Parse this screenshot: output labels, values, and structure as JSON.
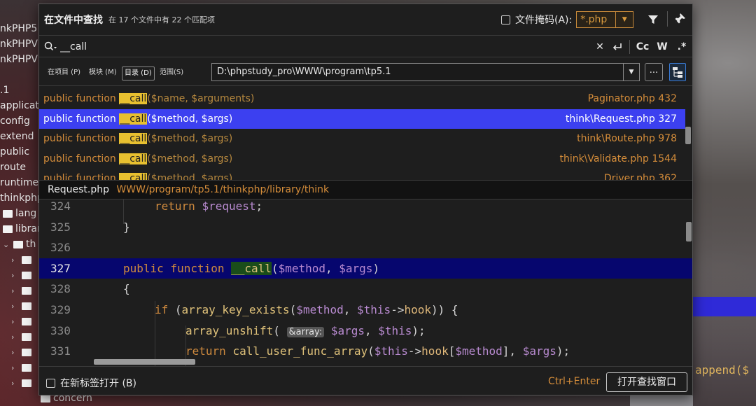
{
  "background": {
    "tree_items": [
      "nkPHP5",
      "nkPHPV",
      "nkPHPV",
      ".1",
      "applicati",
      "config",
      "extend",
      "public",
      "route",
      "runtime",
      "thinkphp",
      "lang",
      "librar",
      "th",
      "concern"
    ],
    "append_text": "append($"
  },
  "dialog": {
    "title": "在文件中查找",
    "match_summary": "在 17 个文件中有 22 个匹配项",
    "file_mask": {
      "label": "文件掩码(A):",
      "value": "*.php",
      "checked": false
    },
    "search": {
      "query": "__call",
      "placeholder": "",
      "toggles": {
        "match_case": "Cc",
        "words": "W",
        "regex": ".*"
      }
    },
    "scope": {
      "tabs": [
        "在项目 (P)",
        "模块 (M)",
        "目录 (D)",
        "范围(S)"
      ],
      "active_tab_index": 2,
      "directory": "D:\\phpstudy_pro\\WWW\\program\\tp5.1",
      "browse_label": "..."
    },
    "results": [
      {
        "prefix": "public function ",
        "match": "__call",
        "rest": "($name, $arguments)",
        "location": "Paginator.php 432",
        "selected": false
      },
      {
        "prefix": "public function ",
        "match": "__call",
        "rest": "($method, $args)",
        "location": "think\\Request.php 327",
        "selected": true
      },
      {
        "prefix": "public function ",
        "match": "__call",
        "rest": "($method, $args)",
        "location": "think\\Route.php 978",
        "selected": false
      },
      {
        "prefix": "public function ",
        "match": "__call",
        "rest": "($method, $args)",
        "location": "think\\Validate.php 1544",
        "selected": false
      },
      {
        "prefix": "public function ",
        "match": "__call",
        "rest": "($method, $args)",
        "location": "Driver.php 362",
        "selected": false
      }
    ],
    "preview": {
      "file_name": "Request.php",
      "file_path": "WWW/program/tp5.1/thinkphp/library/think",
      "lines": [
        {
          "no": "324",
          "tokens": [
            [
              "kw",
              "return "
            ],
            [
              "var",
              "$request"
            ],
            [
              "plain",
              ";"
            ]
          ],
          "indent": 2
        },
        {
          "no": "325",
          "tokens": [
            [
              "plain",
              "}"
            ]
          ],
          "indent": 1
        },
        {
          "no": "326",
          "tokens": [],
          "indent": 0
        },
        {
          "no": "327",
          "tokens": [
            [
              "kw",
              "public function "
            ],
            [
              "fnhl",
              "__call"
            ],
            [
              "plain",
              "("
            ],
            [
              "var",
              "$method"
            ],
            [
              "plain",
              ", "
            ],
            [
              "var",
              "$args"
            ],
            [
              "plain",
              ")"
            ]
          ],
          "indent": 1,
          "current": true
        },
        {
          "no": "328",
          "tokens": [
            [
              "plain",
              "{"
            ]
          ],
          "indent": 1
        },
        {
          "no": "329",
          "tokens": [
            [
              "kw",
              "if "
            ],
            [
              "plain",
              "("
            ],
            [
              "fn",
              "array_key_exists"
            ],
            [
              "plain",
              "("
            ],
            [
              "var",
              "$method"
            ],
            [
              "plain",
              ", "
            ],
            [
              "var",
              "$this"
            ],
            [
              "plain",
              "->"
            ],
            [
              "prop",
              "hook"
            ],
            [
              "plain",
              ")) {"
            ]
          ],
          "indent": 2
        },
        {
          "no": "330",
          "tokens": [
            [
              "fn",
              "array_unshift"
            ],
            [
              "plain",
              "( "
            ],
            [
              "inlay",
              "&array:"
            ],
            [
              "plain",
              " "
            ],
            [
              "var",
              "$args"
            ],
            [
              "plain",
              ", "
            ],
            [
              "var",
              "$this"
            ],
            [
              "plain",
              ");"
            ]
          ],
          "indent": 3
        },
        {
          "no": "331",
          "tokens": [
            [
              "kw",
              "return "
            ],
            [
              "fn",
              "call_user_func_array"
            ],
            [
              "plain",
              "("
            ],
            [
              "var",
              "$this"
            ],
            [
              "plain",
              "->"
            ],
            [
              "prop",
              "hook"
            ],
            [
              "plain",
              "["
            ],
            [
              "var",
              "$method"
            ],
            [
              "plain",
              "], "
            ],
            [
              "var",
              "$args"
            ],
            [
              "plain",
              ");"
            ]
          ],
          "indent": 3
        }
      ]
    },
    "footer": {
      "open_in_new_tab": "在新标签打开 (B)",
      "shortcut": "Ctrl+Enter",
      "open_window_button": "打开查找窗口"
    }
  },
  "colors": {
    "accent_selection": "#3c40f0",
    "match_highlight": "#e8c030",
    "keyword": "#cf8a3e",
    "variable": "#b98bd1",
    "current_line": "#06066e"
  }
}
